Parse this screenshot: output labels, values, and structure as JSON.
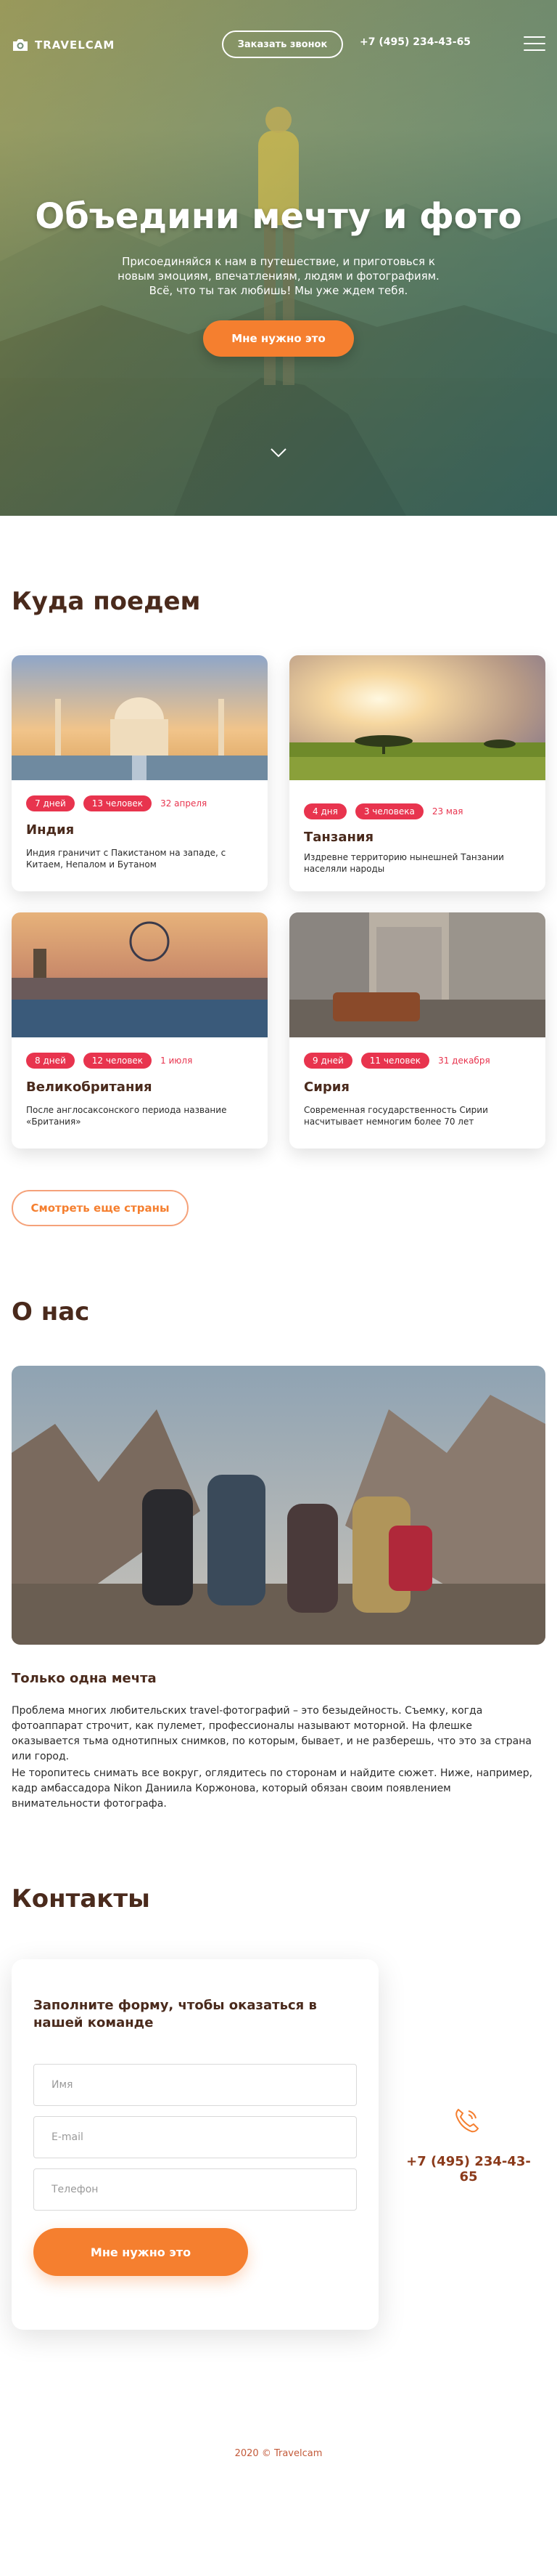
{
  "header": {
    "logo_text": "TRAVELCAM",
    "logo_icon": "camera-icon",
    "callback_label": "Заказать звонок",
    "phone": "+7 (495) 234-43-65",
    "menu_icon": "burger-menu-icon"
  },
  "hero": {
    "title": "Объедини мечту и фото",
    "subtitle": "Присоединяйся к нам в путешествие, и приготовься к новым эмоциям, впечатлениям, людям и фотографиям. Всё, что ты так любишь! Мы уже ждем тебя.",
    "cta_label": "Мне нужно это",
    "scroll_icon": "chevron-down-icon"
  },
  "destinations": {
    "title": "Куда поедем",
    "cards": [
      {
        "name": "Индия",
        "days": "7 дней",
        "people": "13 человек",
        "date": "32 апреля",
        "desc": "Индия граничит с Пакистаном на западе, с Китаем, Непалом и Бутаном"
      },
      {
        "name": "Танзания",
        "days": "4 дня",
        "people": "3 человека",
        "date": "23 мая",
        "desc": "Издревне территорию нынешней Танзании населяли народы"
      },
      {
        "name": "Великобритания",
        "days": "8 дней",
        "people": "12 человек",
        "date": "1 июля",
        "desc": "После англосаксонского периода название «Британия»"
      },
      {
        "name": "Сирия",
        "days": "9 дней",
        "people": "11 человек",
        "date": "31 декабря",
        "desc": "Современная государственность Сирии насчитывает немногим более 70 лет"
      }
    ],
    "more_label": "Смотреть еще страны"
  },
  "about": {
    "title": "О нас",
    "subtitle": "Только одна мечта",
    "paragraph1": "Проблема многих любительских travel-фотографий – это безыдейность. Съемку, когда фотоаппарат строчит, как пулемет, профессионалы называют моторной. На флешке оказывается тьма однотипных снимков, по которым, бывает, и не разберешь, что это за страна или город.",
    "paragraph2": "Не торопитесь снимать все вокруг, оглядитесь по сторонам и найдите сюжет. Ниже, например, кадр амбассадора Nikon Даниила Коржонова, который обязан своим появлением внимательности фотографа."
  },
  "contacts": {
    "title": "Контакты",
    "form_title": "Заполните форму, чтобы оказаться в нашей команде",
    "name_placeholder": "Имя",
    "email_placeholder": "E-mail",
    "phone_placeholder": "Телефон",
    "submit_label": "Мне нужно это",
    "phone_icon": "phone-icon",
    "phone": "+7 (495) 234-43-65"
  },
  "footer": {
    "copyright": "2020 © Travelcam"
  },
  "colors": {
    "accent": "#f57f2f",
    "tag": "#e8344e",
    "heading": "#4a2a1c"
  }
}
